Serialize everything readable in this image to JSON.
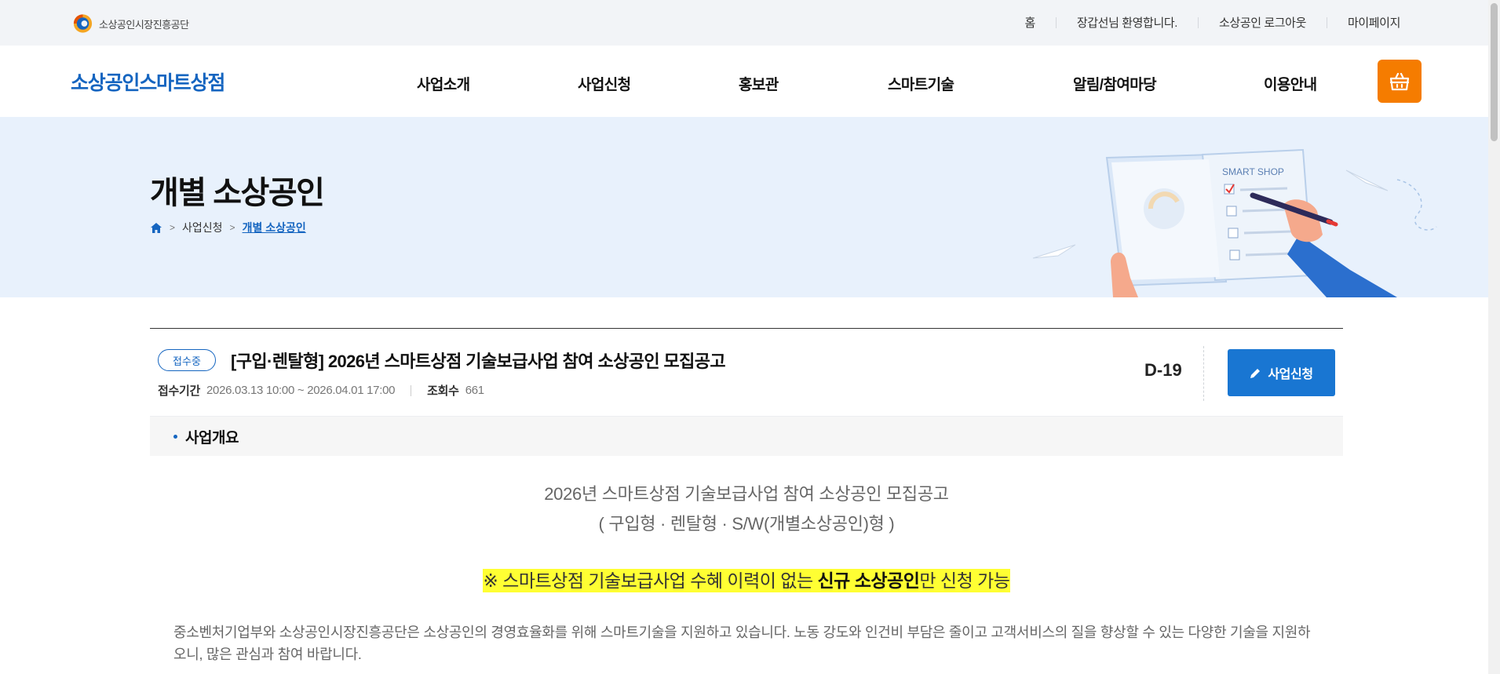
{
  "util_bar": {
    "org_name": "소상공인시장진흥공단",
    "links": [
      "홈",
      "장갑선님 환영합니다.",
      "소상공인 로그아웃",
      "마이페이지"
    ]
  },
  "nav": {
    "brand": "소상공인스마트상점",
    "menu": [
      "사업소개",
      "사업신청",
      "홍보관",
      "스마트기술",
      "알림/참여마당",
      "이용안내"
    ],
    "cart_icon": "shopping-basket-icon",
    "accent_color": "#f57c00"
  },
  "hero": {
    "title": "개별 소상공인",
    "breadcrumb": [
      "사업신청",
      "개별 소상공인"
    ],
    "illustration_text": "SMART SHOP"
  },
  "notice": {
    "status_badge": "접수중",
    "title": "[구입·렌탈형] 2026년 스마트상점 기술보급사업 참여 소상공인 모집공고",
    "period_label": "접수기간",
    "period_value": "2026.03.13 10:00 ~ 2026.04.01 17:00",
    "views_label": "조회수",
    "views_value": "661",
    "dday": "D-19",
    "apply_button": "사업신청",
    "brand_color": "#1976d2"
  },
  "section": {
    "label": "사업개요"
  },
  "content": {
    "heading_line1": "2026년 스마트상점 기술보급사업 참여 소상공인 모집공고",
    "heading_line2": "( 구입형 · 렌탈형 · S/W(개별소상공인)형 )",
    "highlight_prefix": "※ 스마트상점 기술보급사업 수혜 이력이 없는 ",
    "highlight_bold": "신규 소상공인",
    "highlight_suffix": "만 신청 가능",
    "paragraph": "중소벤처기업부와 소상공인시장진흥공단은 소상공인의 경영효율화를 위해 스마트기술을 지원하고 있습니다. 노동 강도와 인건비 부담은 줄이고 고객서비스의 질을 향상할 수 있는 다양한 기술을 지원하오니, 많은 관심과 참여 바랍니다."
  }
}
